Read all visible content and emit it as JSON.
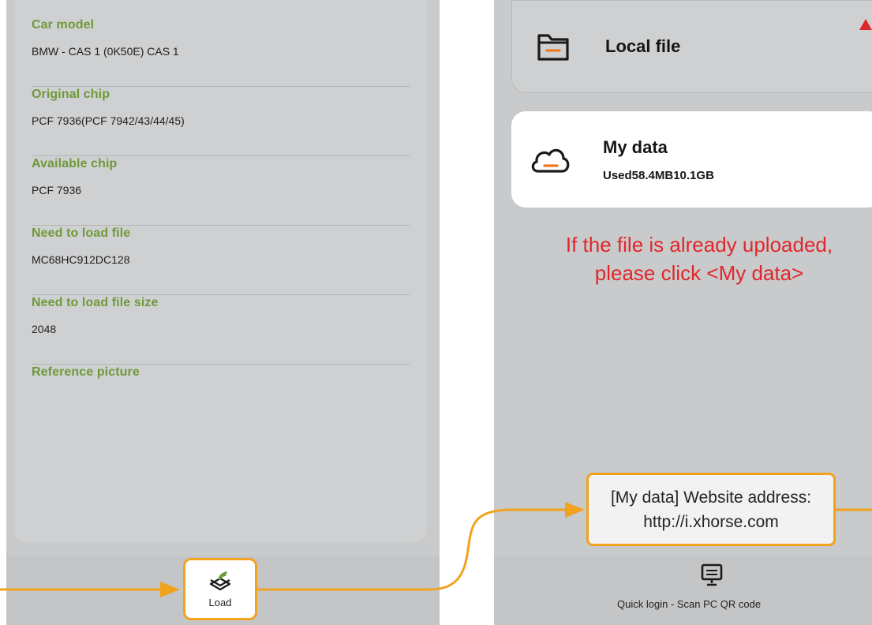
{
  "left_screen": {
    "fields": [
      {
        "label": "Car model",
        "value": "BMW - CAS 1 (0K50E) CAS 1"
      },
      {
        "label": "Original chip",
        "value": "PCF 7936(PCF 7942/43/44/45)"
      },
      {
        "label": "Available chip",
        "value": "PCF 7936"
      },
      {
        "label": "Need to load file",
        "value": "MC68HC912DC128"
      },
      {
        "label": "Need to load file size",
        "value": "2048"
      },
      {
        "label": "Reference picture",
        "value": ""
      }
    ],
    "load_button": {
      "label": "Load",
      "icon": "load-icon"
    }
  },
  "right_screen": {
    "local_file": {
      "label": "Local file",
      "icon": "folder-icon"
    },
    "my_data": {
      "title": "My data",
      "usage": "Used58.4MB10.1GB",
      "icon": "cloud-icon"
    },
    "note_line1": "If the file is already uploaded,",
    "note_line2": "please click <My data>",
    "quick_login": {
      "label": "Quick login - Scan PC QR code",
      "icon": "monitor-icon"
    }
  },
  "callout": {
    "line1": "[My data] Website address:",
    "line2": "http://i.xhorse.com"
  },
  "colors": {
    "label_green": "#6e9a3a",
    "highlight_orange": "#f1a21f",
    "note_red": "#e1262b",
    "panel_gray": "#c9cacb"
  }
}
